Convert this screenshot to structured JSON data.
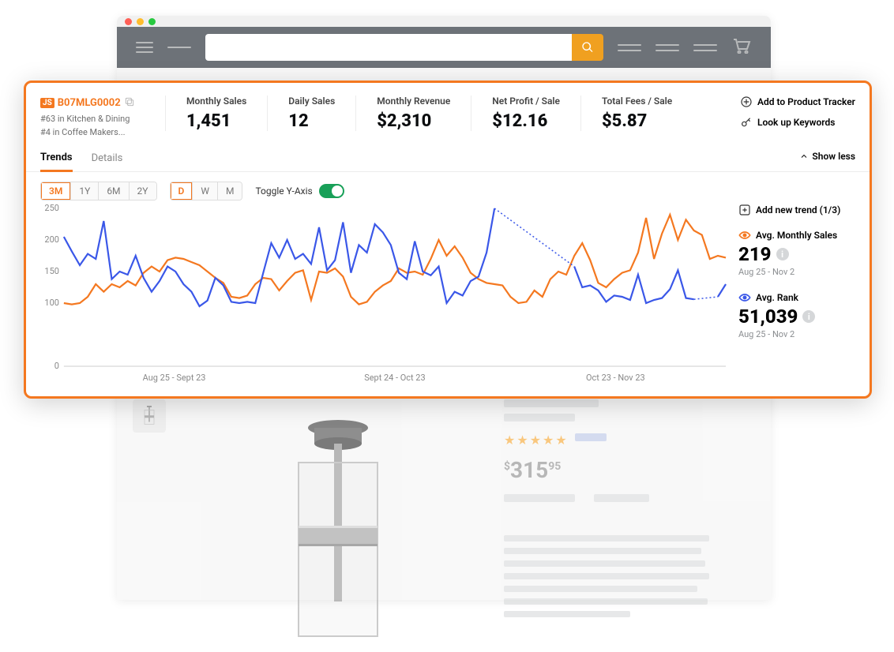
{
  "browser": {
    "search_placeholder": ""
  },
  "product": {
    "asin": "B07MLG0002",
    "category_1": "#63 in Kitchen & Dining",
    "category_2": "#4 in Coffee Makers...",
    "price_currency": "$",
    "price_whole": "315",
    "price_cents": "95"
  },
  "metrics": {
    "monthly_sales_label": "Monthly Sales",
    "monthly_sales_value": "1,451",
    "daily_sales_label": "Daily Sales",
    "daily_sales_value": "12",
    "monthly_revenue_label": "Monthly Revenue",
    "monthly_revenue_value": "$2,310",
    "net_profit_label": "Net Profit / Sale",
    "net_profit_value": "$12.16",
    "total_fees_label": "Total Fees / Sale",
    "total_fees_value": "$5.87"
  },
  "actions": {
    "add_tracker": "Add to Product Tracker",
    "lookup_keywords": "Look up Keywords"
  },
  "tabs": {
    "trends": "Trends",
    "details": "Details",
    "show_less": "Show less"
  },
  "controls": {
    "range": {
      "m3": "3M",
      "y1": "1Y",
      "m6": "6M",
      "y2": "2Y"
    },
    "gran": {
      "d": "D",
      "w": "W",
      "m": "M"
    },
    "toggle_y": "Toggle Y-Axis"
  },
  "sidebar": {
    "add_new_trend": "Add new trend (1/3)",
    "monthly_sales": {
      "label": "Avg. Monthly Sales",
      "value": "219",
      "range": "Aug 25 - Nov 2",
      "color": "#f47820"
    },
    "avg_rank": {
      "label": "Avg. Rank",
      "value": "51,039",
      "range": "Aug 25 - Nov 2",
      "color": "#3a57e8"
    }
  },
  "chart_data": {
    "type": "line",
    "ylim": [
      0,
      250
    ],
    "y_ticks": [
      0,
      100,
      150,
      200,
      250
    ],
    "x_labels": [
      "Aug 25 - Sept 23",
      "Sept 24 - Oct 23",
      "Oct 23 - Nov 23"
    ],
    "series": [
      {
        "name": "Avg. Monthly Sales",
        "color": "#f47820",
        "values": [
          100,
          98,
          100,
          110,
          130,
          118,
          130,
          125,
          135,
          128,
          148,
          158,
          150,
          168,
          172,
          170,
          165,
          160,
          150,
          140,
          132,
          110,
          108,
          112,
          130,
          140,
          138,
          120,
          135,
          148,
          152,
          105,
          150,
          148,
          155,
          142,
          110,
          98,
          102,
          118,
          128,
          135,
          155,
          148,
          150,
          145,
          170,
          200,
          175,
          190,
          172,
          148,
          138,
          132,
          130,
          128,
          110,
          100,
          102,
          120,
          110,
          138,
          150,
          145,
          175,
          195,
          168,
          132,
          125,
          138,
          148,
          152,
          180,
          235,
          170,
          210,
          240,
          200,
          232,
          215,
          208,
          170,
          175,
          172
        ]
      },
      {
        "name": "Avg. Rank",
        "color": "#3a57e8",
        "values": [
          205,
          182,
          160,
          178,
          170,
          230,
          138,
          150,
          145,
          175,
          140,
          118,
          135,
          158,
          150,
          130,
          118,
          95,
          104,
          140,
          128,
          102,
          100,
          102,
          100,
          148,
          195,
          172,
          200,
          170,
          178,
          162,
          220,
          152,
          168,
          228,
          148,
          192,
          180,
          225,
          212,
          192,
          148,
          138,
          198,
          150,
          144,
          158,
          100,
          118,
          112,
          135,
          142,
          180,
          250,
          null,
          null,
          null,
          null,
          null,
          null,
          null,
          null,
          null,
          158,
          125,
          128,
          120,
          102,
          112,
          110,
          105,
          145,
          100,
          105,
          108,
          122,
          152,
          108,
          106,
          null,
          null,
          110,
          130
        ]
      }
    ]
  }
}
